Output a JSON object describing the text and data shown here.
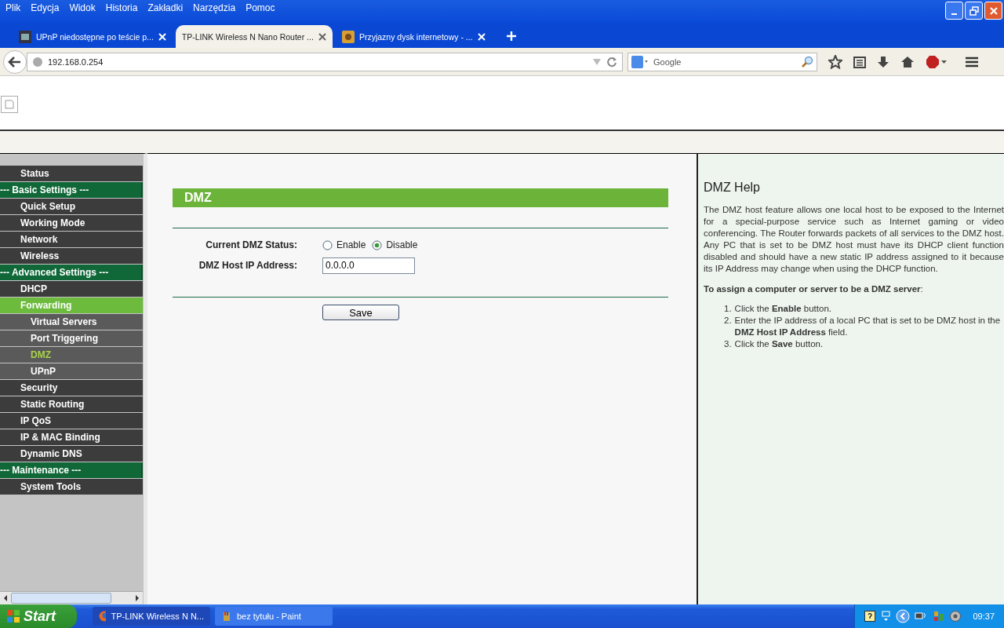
{
  "menu_bar": [
    "Plik",
    "Edycja",
    "Widok",
    "Historia",
    "Zakładki",
    "Narzędzia",
    "Pomoc"
  ],
  "tabs": [
    {
      "title": "UPnP niedostępne po teście p...",
      "selected": false
    },
    {
      "title": "TP-LINK Wireless N Nano Router ...",
      "selected": true
    },
    {
      "title": "Przyjazny dysk internetowy - ...",
      "selected": false
    }
  ],
  "address_bar": {
    "url": "192.168.0.254"
  },
  "search": {
    "placeholder": "Google"
  },
  "sidebar": {
    "items": [
      {
        "kind": "item",
        "label": "Status",
        "selected": false
      },
      {
        "kind": "heading",
        "label": "--- Basic Settings ---"
      },
      {
        "kind": "item",
        "label": "Quick Setup",
        "selected": false
      },
      {
        "kind": "item",
        "label": "Working Mode",
        "selected": false
      },
      {
        "kind": "item",
        "label": "Network",
        "selected": false
      },
      {
        "kind": "item",
        "label": "Wireless",
        "selected": false
      },
      {
        "kind": "heading",
        "label": "--- Advanced Settings ---"
      },
      {
        "kind": "item",
        "label": "DHCP",
        "selected": false
      },
      {
        "kind": "item",
        "label": "Forwarding",
        "selected": false,
        "expanded": true,
        "children": [
          {
            "kind": "item",
            "label": "Virtual Servers",
            "selected": false
          },
          {
            "kind": "item",
            "label": "Port Triggering",
            "selected": false
          },
          {
            "kind": "item",
            "label": "DMZ",
            "selected": true
          },
          {
            "kind": "item",
            "label": "UPnP",
            "selected": false
          }
        ]
      },
      {
        "kind": "item",
        "label": "Security",
        "selected": false
      },
      {
        "kind": "item",
        "label": "Static Routing",
        "selected": false
      },
      {
        "kind": "item",
        "label": "IP QoS",
        "selected": false
      },
      {
        "kind": "item",
        "label": "IP & MAC Binding",
        "selected": false
      },
      {
        "kind": "item",
        "label": "Dynamic DNS",
        "selected": false
      },
      {
        "kind": "heading",
        "label": "--- Maintenance ---"
      },
      {
        "kind": "item",
        "label": "System Tools",
        "selected": false
      }
    ]
  },
  "main": {
    "title": "DMZ",
    "status_label": "Current DMZ Status:",
    "status_options": [
      {
        "label": "Enable",
        "selected": false
      },
      {
        "label": "Disable",
        "selected": true
      }
    ],
    "ip_label": "DMZ Host IP Address:",
    "ip_value": "0.0.0.0",
    "save_button": "Save"
  },
  "help": {
    "title": "DMZ Help",
    "paragraph": "The DMZ host feature allows one local host to be exposed to the Internet for a special-purpose service such as Internet gaming or video conferencing. The Router forwards packets of all services to the DMZ host. Any PC that is set to be DMZ host must have its DHCP client function disabled and should have a new static IP address assigned to it because its IP Address may change when using the DHCP function.",
    "subheading": "**To assign a computer or server to be a DMZ server**:",
    "steps": [
      {
        "number": "1.",
        "text": "Click the **Enable** button."
      },
      {
        "number": "2.",
        "text": "Enter the IP address of a local PC that is set to be DMZ host in the **DMZ Host IP Address** field."
      },
      {
        "number": "3.",
        "text": "Click the **Save** button."
      }
    ]
  },
  "taskbar": {
    "start": "Start",
    "tasks": [
      {
        "label": "TP-LINK Wireless N N...",
        "selected": true
      },
      {
        "label": "bez tytułu - Paint",
        "selected": false
      }
    ],
    "clock": "09:37"
  }
}
